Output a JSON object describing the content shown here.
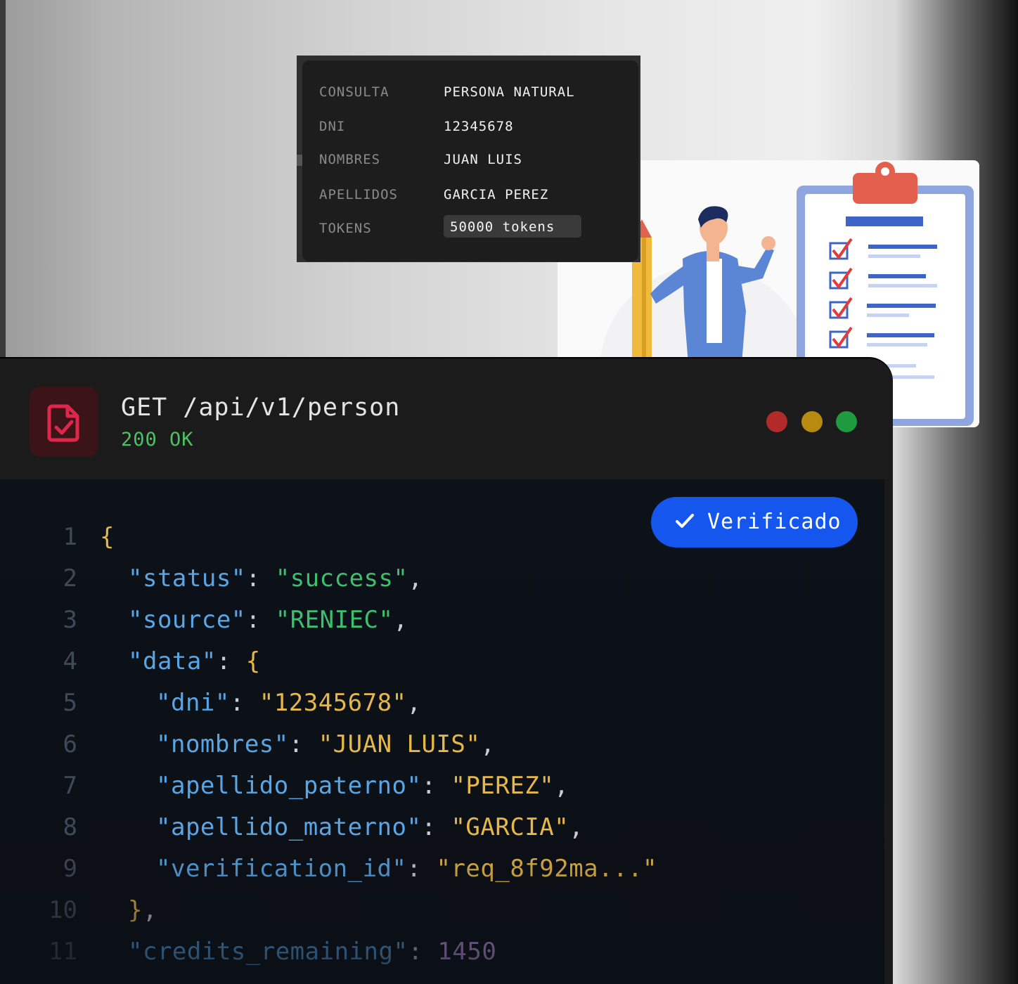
{
  "info_card": {
    "rows": [
      {
        "key": "CONSULTA",
        "value": "PERSONA NATURAL"
      },
      {
        "key": "DNI",
        "value": "12345678"
      },
      {
        "key": "NOMBRES",
        "value": "JUAN LUIS"
      },
      {
        "key": "APELLIDOS",
        "value": "GARCIA PEREZ"
      },
      {
        "key": "TOKENS",
        "value": "50000 tokens"
      }
    ]
  },
  "terminal": {
    "method_path": "GET /api/v1/person",
    "status": "200 OK",
    "icon": "file-check-icon",
    "window_dots": {
      "red": "#b22a2a",
      "yellow": "#b88a10",
      "green": "#1f9a3e"
    },
    "badge": {
      "label": "Verificado",
      "icon": "checkmark-icon",
      "color": "#1557ee"
    },
    "line_numbers": [
      "1",
      "2",
      "3",
      "4",
      "5",
      "6",
      "7",
      "8",
      "9",
      "10",
      "11"
    ],
    "code": {
      "l1_open": "{",
      "l2_key": "\"status\"",
      "l2_colon": ":",
      "l2_val": "\"success\"",
      "l2_comma": ",",
      "l3_key": "\"source\"",
      "l3_colon": ":",
      "l3_val": "\"RENIEC\"",
      "l3_comma": ",",
      "l4_key": "\"data\"",
      "l4_colon": ":",
      "l4_open": "{",
      "l5_key": "\"dni\"",
      "l5_colon": ":",
      "l5_val": "\"12345678\"",
      "l5_comma": ",",
      "l6_key": "\"nombres\"",
      "l6_colon": ":",
      "l6_val": "\"JUAN LUIS\"",
      "l6_comma": ",",
      "l7_key": "\"apellido_paterno\"",
      "l7_colon": ":",
      "l7_val": "\"PEREZ\"",
      "l7_comma": ",",
      "l8_key": "\"apellido_materno\"",
      "l8_colon": ":",
      "l8_val": "\"GARCIA\"",
      "l8_comma": ",",
      "l9_key": "\"verification_id\"",
      "l9_colon": ":",
      "l9_val": "\"req_8f92ma...\"",
      "l10_close": "}",
      "l10_comma": ",",
      "l11_key": "\"credits_remaining\"",
      "l11_colon": ":",
      "l11_val": "1450"
    }
  },
  "illustration": {
    "subject": "person-with-pencil-and-checklist-clipboard"
  }
}
